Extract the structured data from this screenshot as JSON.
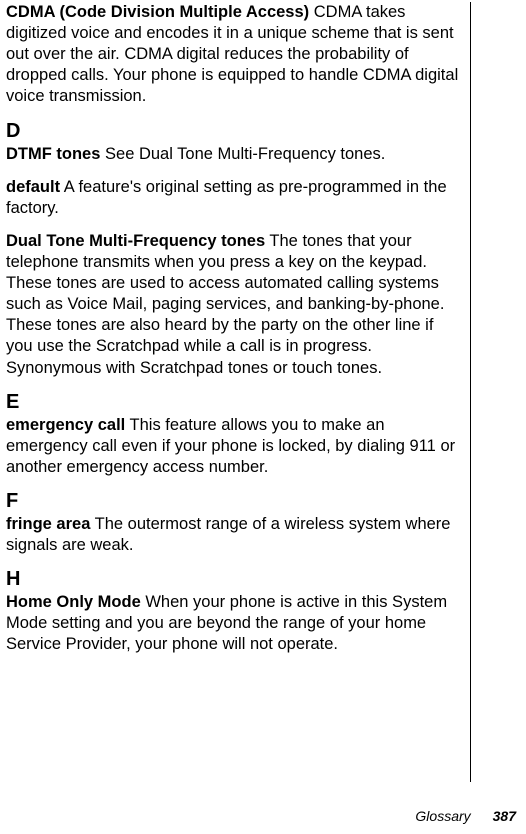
{
  "entries": {
    "cdma": {
      "term": "CDMA (Code Division Multiple Access)",
      "def": "  CDMA takes digitized voice and encodes it in a unique scheme that is sent out over the air. CDMA digital reduces the probability of dropped calls. Your phone is equipped to handle CDMA digital voice transmission."
    },
    "dtmf": {
      "term": "DTMF tones",
      "def": "  See Dual Tone Multi-Frequency tones."
    },
    "default": {
      "term": "default",
      "def": "   A feature's original setting as pre-programmed in the factory."
    },
    "dualtone": {
      "term": "Dual Tone Multi-Frequency tones",
      "def": "  The tones that your telephone transmits when you press a key on the keypad. These tones are used to access automated calling systems such as Voice Mail, paging services, and banking-by-phone. These tones are also heard by the party on the other line if you use the Scratchpad while a call is in progress. Synonymous with Scratchpad tones or touch tones."
    },
    "emergency": {
      "term": "emergency call",
      "def": "   This feature allows you to make an emergency call even if your phone is locked, by dialing 911 or another emergency access number."
    },
    "fringe": {
      "term": "fringe area",
      "def": "  The outermost range of a wireless system where signals are weak."
    },
    "homeonly": {
      "term": "Home Only Mode",
      "def": "  When your phone is active in this System Mode setting and you are beyond the range of your home Service Provider, your phone will not operate."
    }
  },
  "letters": {
    "d": "D",
    "e": "E",
    "f": "F",
    "h": "H"
  },
  "footer": {
    "label": "Glossary",
    "page": "387"
  }
}
